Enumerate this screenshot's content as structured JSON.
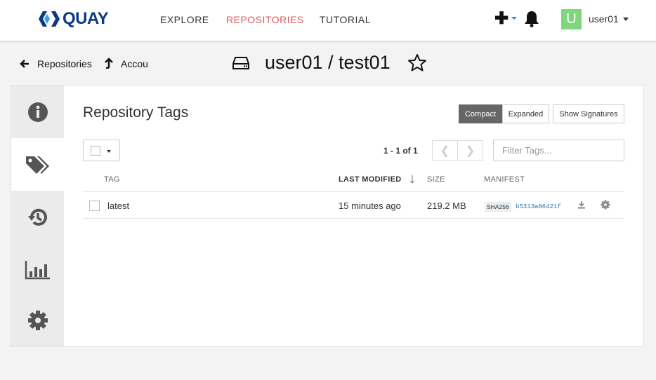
{
  "brand": {
    "name": "QUAY",
    "color": "#0b3a82"
  },
  "nav": {
    "links": [
      {
        "label": "EXPLORE",
        "active": false
      },
      {
        "label": "REPOSITORIES",
        "active": true
      },
      {
        "label": "TUTORIAL",
        "active": false
      }
    ],
    "user": {
      "avatar_letter": "U",
      "name": "user01",
      "avatar_color": "#7ed67e"
    }
  },
  "breadcrumb": {
    "repositories_label": "Repositories",
    "account_label": "Accou"
  },
  "repo": {
    "title": "user01 / test01"
  },
  "sidebar": {
    "tabs": [
      {
        "icon": "info-icon",
        "active": false
      },
      {
        "icon": "tags-icon",
        "active": true
      },
      {
        "icon": "history-icon",
        "active": false
      },
      {
        "icon": "usage-chart-icon",
        "active": false
      },
      {
        "icon": "settings-gear-icon",
        "active": false
      }
    ]
  },
  "tags": {
    "heading": "Repository Tags",
    "view_buttons": {
      "compact": "Compact",
      "expanded": "Expanded",
      "signatures": "Show Signatures"
    },
    "pagination": {
      "range": "1 - 1 of 1",
      "prev": "❮",
      "next": "❯"
    },
    "filter_placeholder": "Filter Tags...",
    "columns": {
      "tag": "TAG",
      "last_modified": "LAST MODIFIED",
      "size": "SIZE",
      "manifest": "MANIFEST"
    },
    "rows": [
      {
        "tag": "latest",
        "last_modified": "15 minutes ago",
        "size": "219.2 MB",
        "digest_type": "SHA256",
        "digest": "b5313a86421f"
      }
    ]
  },
  "colors": {
    "accent_active": "#e0595b",
    "digest_link": "#2a6fb8",
    "active_toggle": "#666666"
  }
}
